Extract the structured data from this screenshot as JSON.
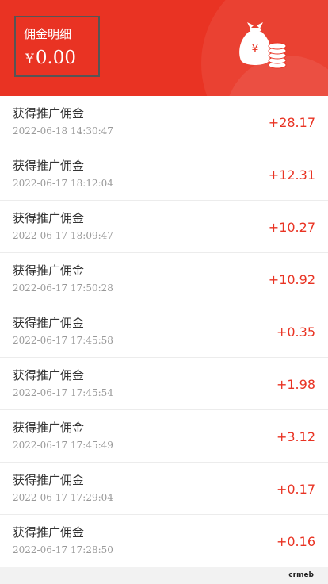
{
  "header": {
    "title": "佣金明细",
    "currency": "¥",
    "amount": "0.00",
    "icon": "money-bag-coins-icon"
  },
  "records": [
    {
      "title": "获得推广佣金",
      "time": "2022-06-18 14:30:47",
      "amount": "+28.17"
    },
    {
      "title": "获得推广佣金",
      "time": "2022-06-17 18:12:04",
      "amount": "+12.31"
    },
    {
      "title": "获得推广佣金",
      "time": "2022-06-17 18:09:47",
      "amount": "+10.27"
    },
    {
      "title": "获得推广佣金",
      "time": "2022-06-17 17:50:28",
      "amount": "+10.92"
    },
    {
      "title": "获得推广佣金",
      "time": "2022-06-17 17:45:58",
      "amount": "+0.35"
    },
    {
      "title": "获得推广佣金",
      "time": "2022-06-17 17:45:54",
      "amount": "+1.98"
    },
    {
      "title": "获得推广佣金",
      "time": "2022-06-17 17:45:49",
      "amount": "+3.12"
    },
    {
      "title": "获得推广佣金",
      "time": "2022-06-17 17:29:04",
      "amount": "+0.17"
    },
    {
      "title": "获得推广佣金",
      "time": "2022-06-17 17:28:50",
      "amount": "+0.16"
    }
  ],
  "watermark": "crmeb",
  "colors": {
    "brand": "#e93323",
    "background": "#f2f2f2"
  }
}
